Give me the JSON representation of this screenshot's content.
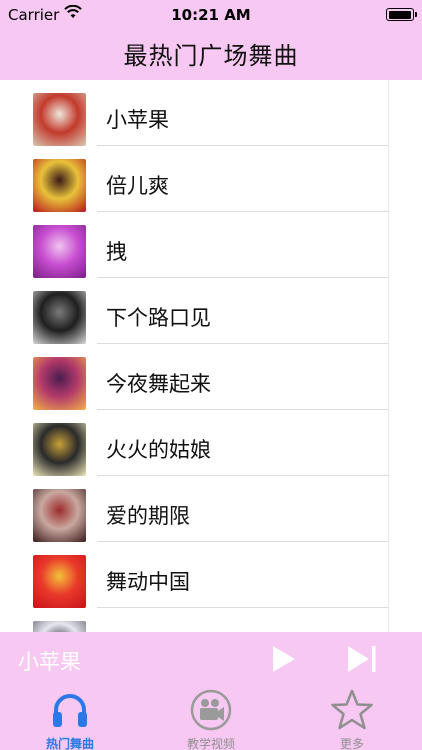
{
  "status_bar": {
    "carrier": "Carrier",
    "time": "10:21 AM"
  },
  "header": {
    "title": "最热门广场舞曲"
  },
  "songs": [
    {
      "title": "小苹果",
      "thumb_colors": [
        "#d9c9b4",
        "#c23a2c",
        "#f0e6dc"
      ]
    },
    {
      "title": "倍儿爽",
      "thumb_colors": [
        "#b5141c",
        "#e8c23a",
        "#3b1a18"
      ]
    },
    {
      "title": "拽",
      "thumb_colors": [
        "#7a1f87",
        "#c84fd1",
        "#f0c5ef"
      ]
    },
    {
      "title": "下个路口见",
      "thumb_colors": [
        "#d8d8d8",
        "#1f1f1f",
        "#7a7a7a"
      ]
    },
    {
      "title": "今夜舞起来",
      "thumb_colors": [
        "#f2b24a",
        "#b33a6a",
        "#4a1d4f"
      ]
    },
    {
      "title": "火火的姑娘",
      "thumb_colors": [
        "#efe6b8",
        "#2a2a2a",
        "#c7a03a"
      ]
    },
    {
      "title": "爱的期限",
      "thumb_colors": [
        "#3a1a1a",
        "#c9a8a0",
        "#9c2b2b"
      ]
    },
    {
      "title": "舞动中国",
      "thumb_colors": [
        "#c9101a",
        "#e83a2a",
        "#f4c23a"
      ]
    },
    {
      "title": "",
      "thumb_colors": [
        "#5a5a6a",
        "#e6e6ee",
        "#2a2a3a"
      ]
    }
  ],
  "player": {
    "now_playing": "小苹果",
    "play_icon": "play-icon",
    "next_icon": "skip-next-icon"
  },
  "tabs": [
    {
      "label": "热门舞曲",
      "icon": "headphones-icon",
      "active": true
    },
    {
      "label": "教学视频",
      "icon": "video-camera-icon",
      "active": false
    },
    {
      "label": "更多",
      "icon": "star-icon",
      "active": false
    }
  ],
  "colors": {
    "accent_pink": "#f7c8f2",
    "tab_active": "#2b78e6",
    "tab_inactive": "#8f8f8f"
  }
}
